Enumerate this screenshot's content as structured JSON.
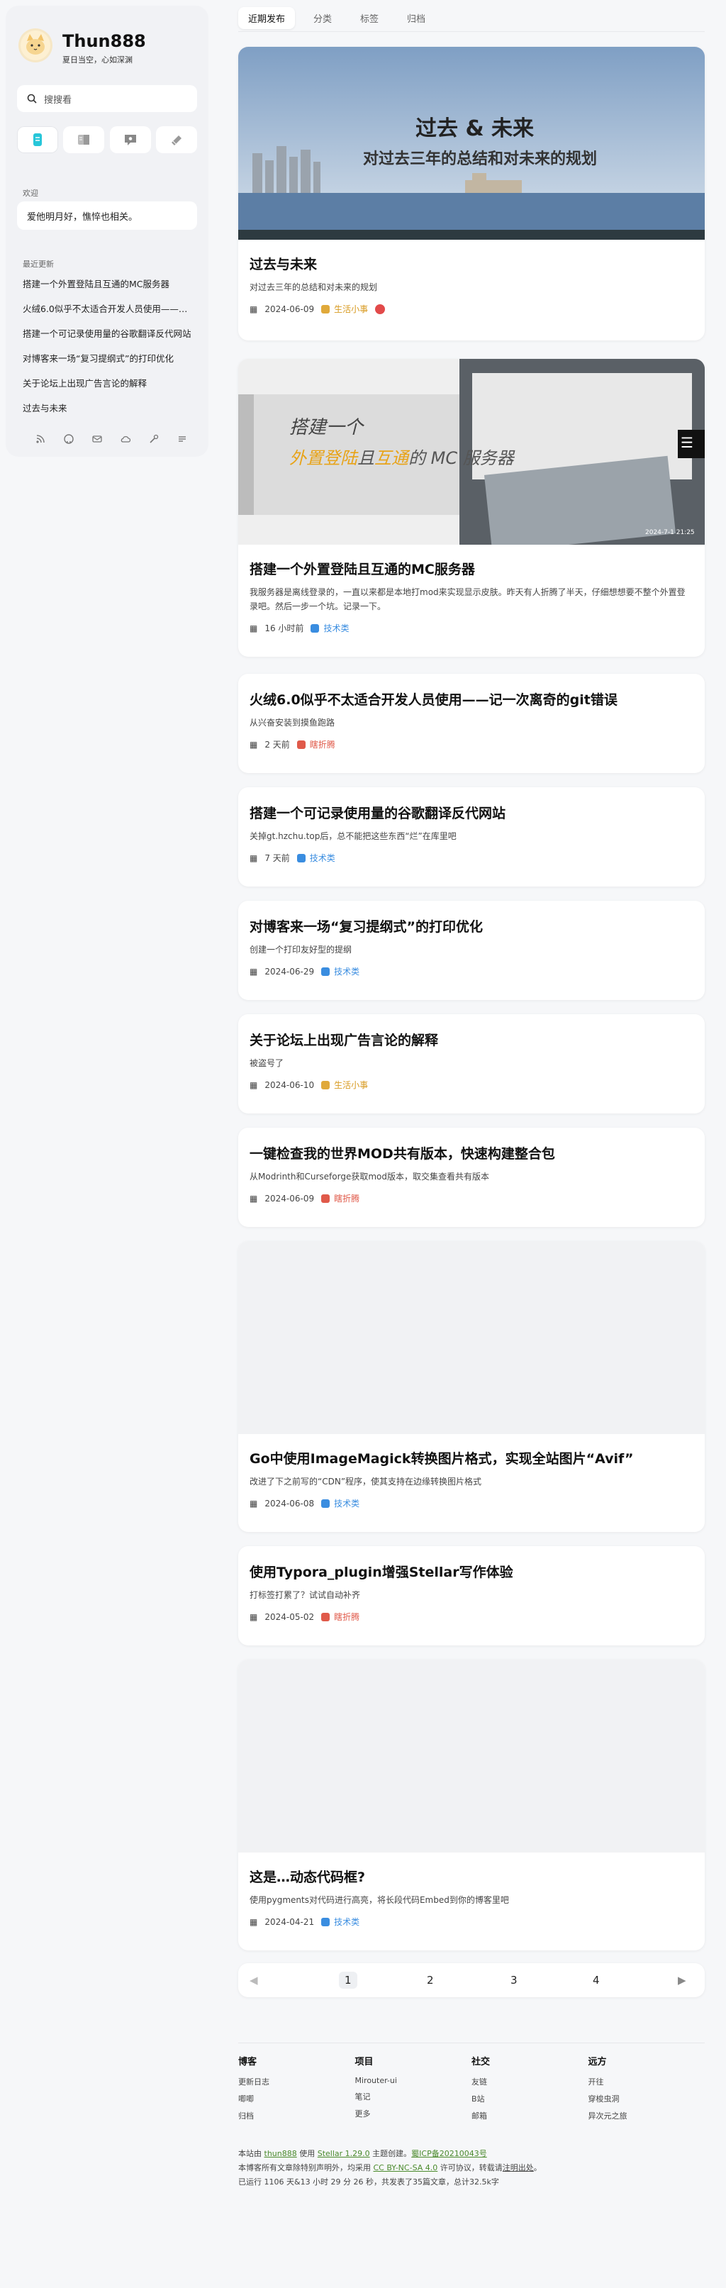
{
  "site": {
    "title": "Thun888",
    "subtitle": "夏日当空，心如深渊",
    "logo_icon": "cat-avatar"
  },
  "search": {
    "placeholder": "搜搜看"
  },
  "nav_icons": [
    "posts-icon",
    "wiki-icon",
    "notes-icon",
    "more-icon"
  ],
  "sidebar": {
    "welcome_heading": "欢迎",
    "welcome_text": "爱他明月好，憔悴也相关。",
    "recent_heading": "最近更新",
    "recent": [
      "搭建一个外置登陆且互通的MC服务器",
      "火绒6.0似乎不太适合开发人员使用——记一次离奇的git错误",
      "搭建一个可记录使用量的谷歌翻译反代网站",
      "对博客来一场“复习提纲式”的打印优化",
      "关于论坛上出现广告言论的解释",
      "过去与未来"
    ],
    "social_icons": [
      "rss-icon",
      "github-icon",
      "mail-icon",
      "cloud-icon",
      "tool-icon",
      "list-icon"
    ]
  },
  "tabs": [
    "近期发布",
    "分类",
    "标签",
    "归档"
  ],
  "posts": [
    {
      "title": "过去与未来",
      "excerpt": "对过去三年的总结和对未来的规划",
      "date": "2024-06-09",
      "category": "生活小事",
      "cat_color": "#e0a93a",
      "cover_text1": "过去 & 未来",
      "cover_text2": "对过去三年的总结和对未来的规划"
    },
    {
      "title": "搭建一个外置登陆且互通的MC服务器",
      "excerpt": "我服务器是离线登录的，一直以来都是本地打mod来实现显示皮肤。昨天有人折腾了半天，仔细想想要不整个外置登录吧。然后一步一个坑。记录一下。",
      "date": "16 小时前",
      "category": "技术类",
      "cat_color": "#3a8de0",
      "cover_text1": "搭建一个",
      "cover_text2a": "外置登陆",
      "cover_text2b": "且",
      "cover_text2c": "互通",
      "cover_text2d": "的 MC 服务器",
      "cover_stamp": "2024-7-1 21:25"
    },
    {
      "title": "火绒6.0似乎不太适合开发人员使用——记一次离奇的git错误",
      "excerpt": "从兴奋安装到摸鱼跑路",
      "date": "2 天前",
      "category": "瞎折腾",
      "cat_color": "#e05a4a"
    },
    {
      "title": "搭建一个可记录使用量的谷歌翻译反代网站",
      "excerpt": "关掉gt.hzchu.top后，总不能把这些东西“烂”在库里吧",
      "date": "7 天前",
      "category": "技术类",
      "cat_color": "#3a8de0"
    },
    {
      "title": "对博客来一场“复习提纲式”的打印优化",
      "excerpt": "创建一个打印友好型的提纲",
      "date": "2024-06-29",
      "category": "技术类",
      "cat_color": "#3a8de0"
    },
    {
      "title": "关于论坛上出现广告言论的解释",
      "excerpt": "被盗号了",
      "date": "2024-06-10",
      "category": "生活小事",
      "cat_color": "#e0a93a"
    },
    {
      "title": "一键检查我的世界MOD共有版本，快速构建整合包",
      "excerpt": "从Modrinth和Curseforge获取mod版本，取交集查看共有版本",
      "date": "2024-06-09",
      "category": "瞎折腾",
      "cat_color": "#e05a4a"
    },
    {
      "title": "Go中使用ImageMagick转换图片格式，实现全站图片“Avif”",
      "excerpt": "改进了下之前写的“CDN”程序，使其支持在边缘转换图片格式",
      "date": "2024-06-08",
      "category": "技术类",
      "cat_color": "#3a8de0"
    },
    {
      "title": "使用Typora_plugin增强Stellar写作体验",
      "excerpt": "打标签打累了？试试自动补齐",
      "date": "2024-05-02",
      "category": "瞎折腾",
      "cat_color": "#e05a4a"
    },
    {
      "title": "这是…动态代码框?",
      "excerpt": "使用pygments对代码进行高亮，将长段代码Embed到你的博客里吧",
      "date": "2024-04-21",
      "category": "技术类",
      "cat_color": "#3a8de0"
    }
  ],
  "pagination": {
    "pages": [
      "1",
      "2",
      "3",
      "4"
    ],
    "current": "1"
  },
  "footer": {
    "columns": [
      {
        "title": "博客",
        "links": [
          "更新日志",
          "唧唧",
          "归档"
        ]
      },
      {
        "title": "项目",
        "links": [
          "Mirouter-ui",
          "笔记",
          "更多"
        ]
      },
      {
        "title": "社交",
        "links": [
          "友链",
          "B站",
          "邮箱"
        ]
      },
      {
        "title": "远方",
        "links": [
          "开往",
          "穿梭虫洞",
          "异次元之旅"
        ]
      }
    ],
    "line1_a": "本站由 ",
    "line1_b": "thun888",
    "line1_c": " 使用 ",
    "line1_d": "Stellar 1.29.0",
    "line1_e": " 主题创建。",
    "line1_f": "蜀ICP备20210043号",
    "line2_a": "本博客所有文章除特别声明外，均采用 ",
    "line2_b": "CC BY-NC-SA 4.0",
    "line2_c": " 许可协议，转载请",
    "line2_d": "注明出处",
    "line2_e": "。",
    "line3": "已运行 1106 天&13 小时 29 分 26 秒，共发表了35篇文章，总计32.5k字"
  }
}
